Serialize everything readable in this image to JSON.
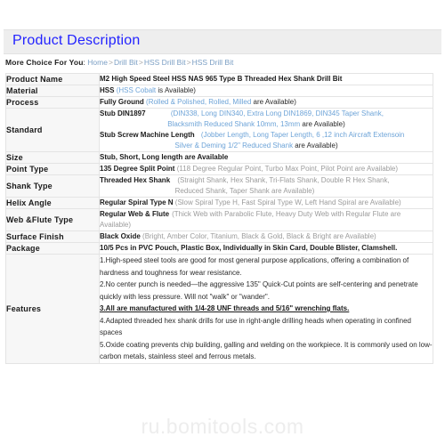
{
  "header": {
    "title": "Product Description"
  },
  "breadcrumb": {
    "label": "More Choice For You",
    "colon": ":",
    "items": [
      "Home",
      "Drill Bit",
      "HSS Drill Bit",
      "HSS Drill Bit"
    ],
    "separator": ">"
  },
  "rows": {
    "product_name": {
      "label": "Product Name",
      "value": "M2 High Speed Steel HSS NAS 965 Type B Threaded Hex Shank Drill Bit"
    },
    "material": {
      "label": "Material",
      "value": "HSS",
      "options": "HSS Cobalt",
      "tail": "is Available)",
      "open_paren": "("
    },
    "process": {
      "label": "Process",
      "value": "Fully Ground",
      "options": "Rolled & Polished, Rolled, Milled",
      "tail": "are Available)",
      "open_paren": "("
    },
    "standard": {
      "label": "Standard",
      "sub1_head": "Stub DIN1897",
      "sub1_opts_line1": "(DIN338, Long DIN340, Extra Long DIN1869, DIN345 Taper Shank,",
      "sub1_opts_line2": "Blacksmith Reduced Shank 10mm, 13mm",
      "sub1_tail": "are Available)",
      "sub2_head": "Stub Screw Machine Length",
      "sub2_opts_line1": "(Jobber Length, Long Taper Length, 6 ,12 inch Aircraft Extensoin",
      "sub2_opts_line2": "Silver & Deming 1/2\" Reduced Shank",
      "sub2_tail": "are Available)"
    },
    "size": {
      "label": "Size",
      "value": "Stub, Short, Long length are Available"
    },
    "point_type": {
      "label": "Point Type",
      "value": "135 Degree Split Point",
      "options": "(118 Degree Regular Point, Turbo Max Point, Pilot Point are Available)"
    },
    "shank_type": {
      "label": "Shank Type",
      "value": "Threaded Hex Shank",
      "options_line1": "(Straight Shank, Hex Shank, Tri-Flats Shank, Double R Hex Shank,",
      "options_line2": "Reduced Shank, Taper Shank are Available)"
    },
    "helix_angle": {
      "label": "Helix Angle",
      "value": "Regular Spiral Type N",
      "options": "(Slow Spiral Type H, Fast Spiral Type W, Left Hand Spiral are Available)"
    },
    "web_flute": {
      "label": "Web &Flute Type",
      "value": "Regular Web & Flute",
      "options": "(Thick Web with Parabolic Flute, Heavy Duty Web with Regular Flute are Available)"
    },
    "surface_finish": {
      "label": "Surface Finish",
      "value": "Black Oxide",
      "options": "(Bright, Amber Color, Titanium, Black & Gold, Black & Bright are Available)"
    },
    "package": {
      "label": "Package",
      "value": "10/5 Pcs in PVC Pouch, Plastic Box, Individually in Skin Card, Double Blister, Clamshell."
    },
    "features": {
      "label": "Features",
      "item1": "1.High-speed steel tools are good for most general purpose applications, offering a combination of hardness   and toughness for wear resistance.",
      "item2": "2.No center punch is needed—the aggressive 135\" Quick-Cut points are self-centering and penetrate quickly   with less pressure. Will not \"walk\" or \"wander\".",
      "item3": "3.All are manufactured with 1/4-28 UNF threads and 5/16\" wrenching flats.",
      "item4": "4.Adapted threaded hex shank drills for use in right-angle drilling heads when operating in confined spaces",
      "item5": "5.Oxide coating prevents chip building, galling and welding on the workpiece. It is commonly used on low-carbon metals, stainless steel and ferrous metals."
    }
  },
  "footer": {
    "watermark": "ru.bomitools.com"
  }
}
